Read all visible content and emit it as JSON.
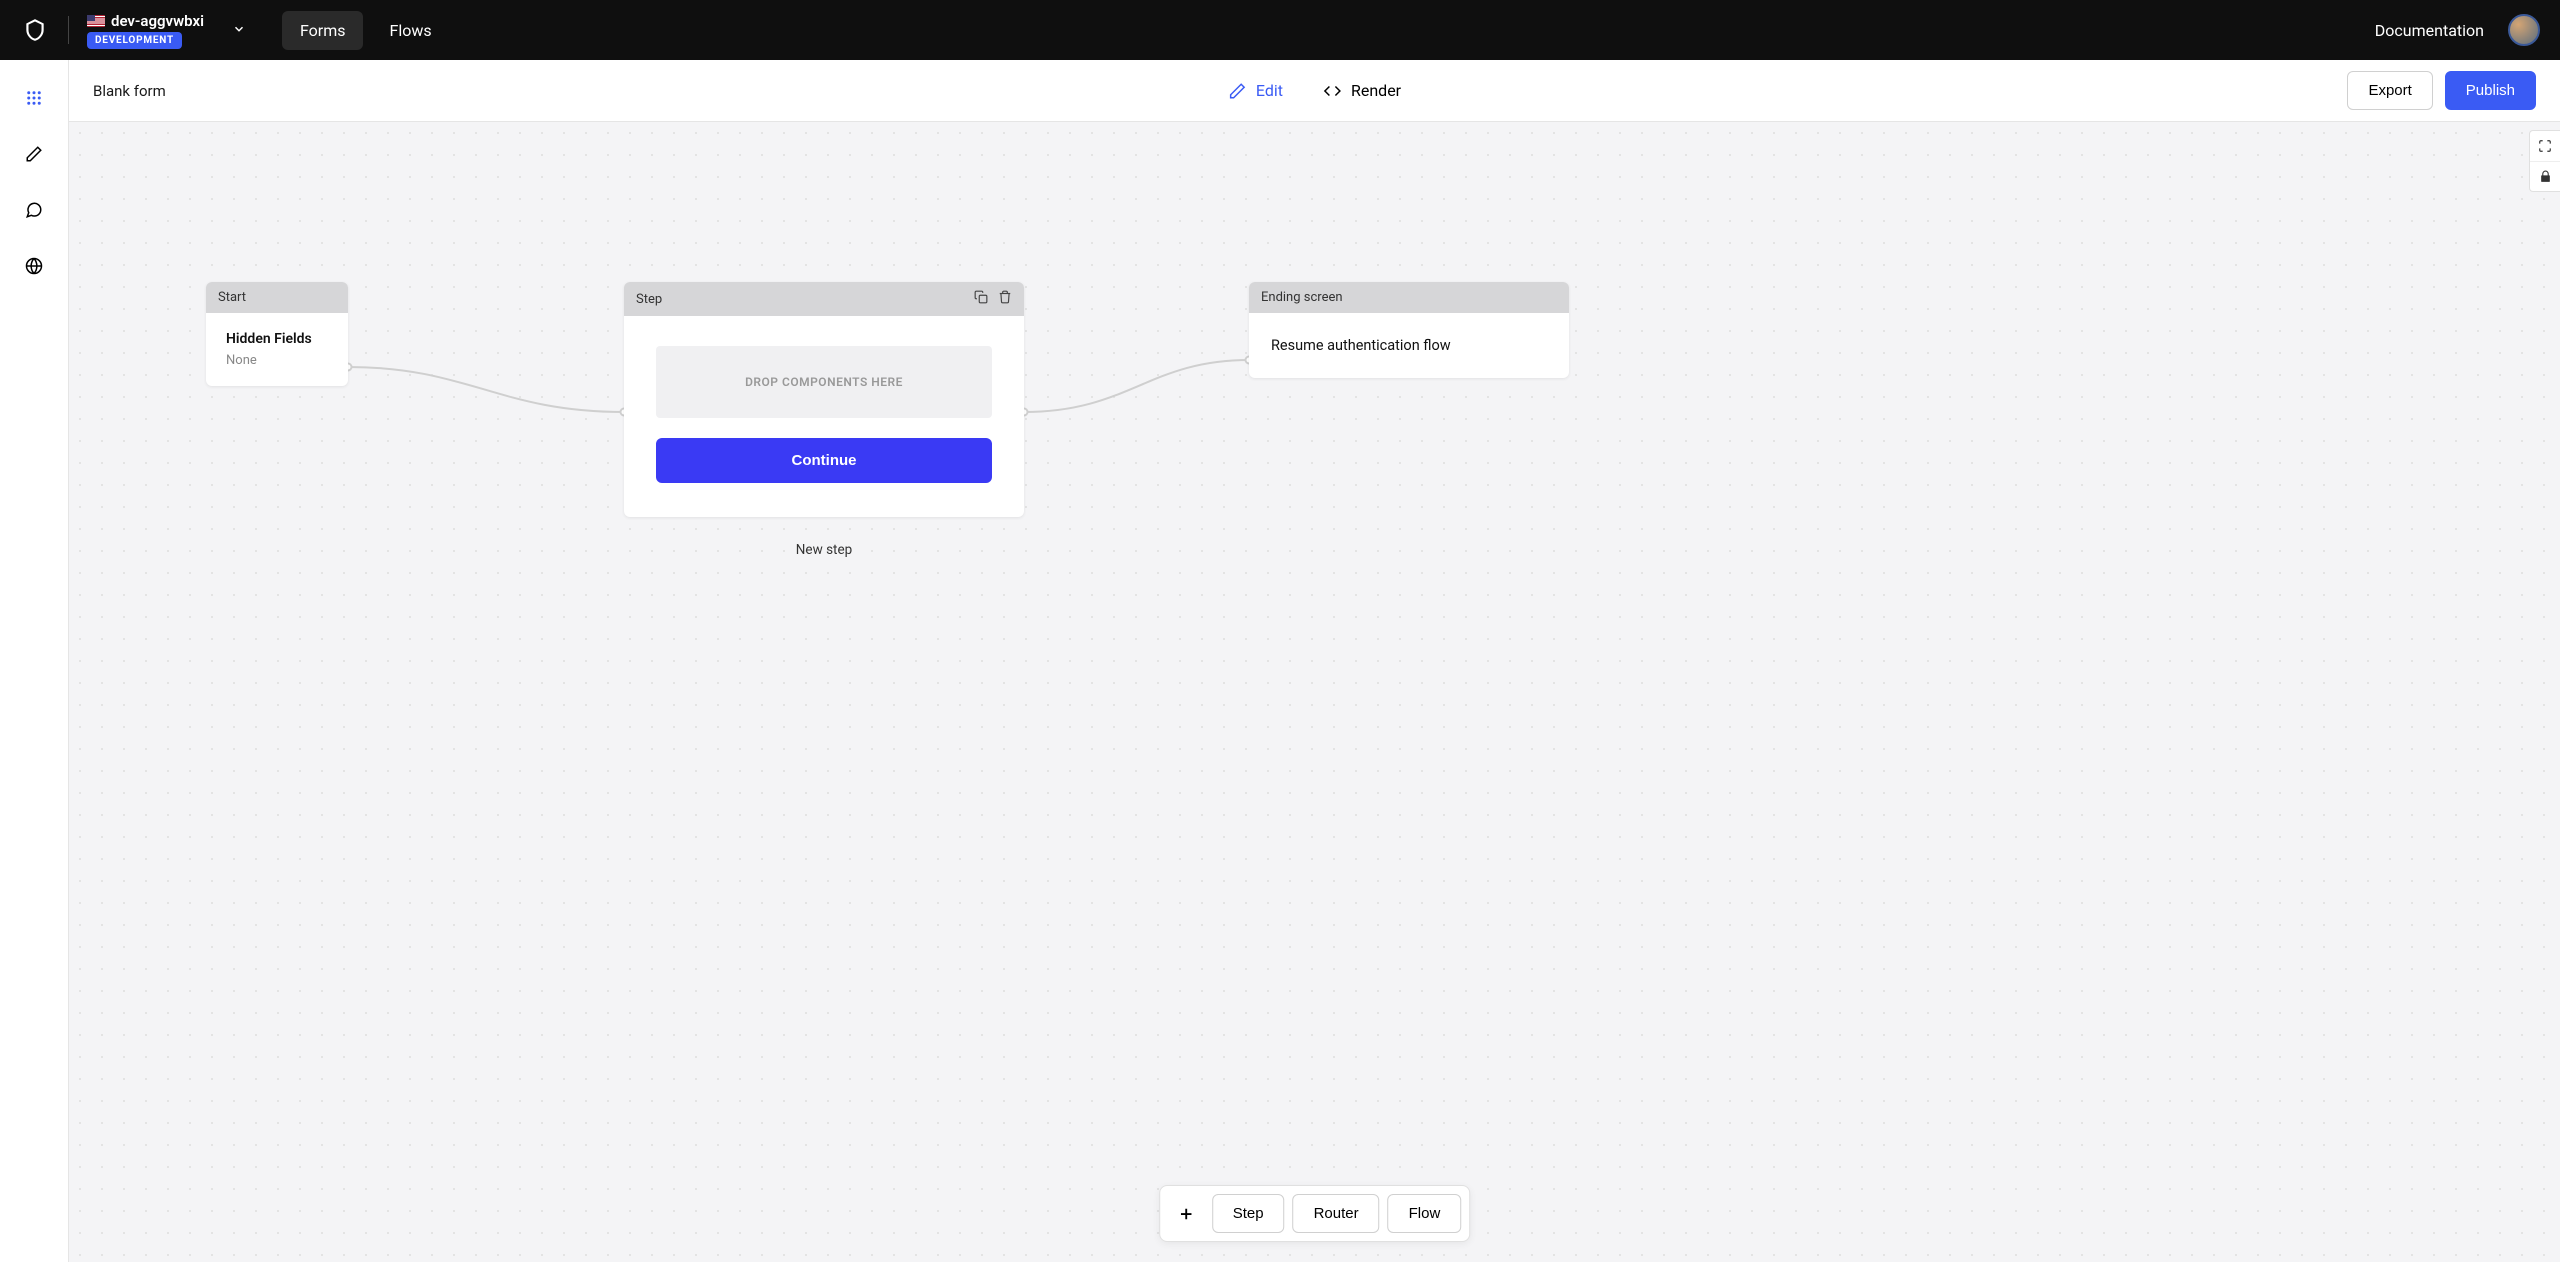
{
  "header": {
    "tenant_name": "dev-aggvwbxi",
    "env_badge": "DEVELOPMENT",
    "tabs": {
      "forms": "Forms",
      "flows": "Flows"
    },
    "documentation": "Documentation"
  },
  "subheader": {
    "form_title": "Blank form",
    "edit": "Edit",
    "render": "Render",
    "export": "Export",
    "publish": "Publish"
  },
  "canvas": {
    "start": {
      "header": "Start",
      "hidden_fields_label": "Hidden Fields",
      "hidden_fields_value": "None"
    },
    "step": {
      "header": "Step",
      "dropzone": "DROP COMPONENTS HERE",
      "continue": "Continue",
      "caption": "New step"
    },
    "end": {
      "header": "Ending screen",
      "body": "Resume authentication flow"
    }
  },
  "bottom_bar": {
    "step": "Step",
    "router": "Router",
    "flow": "Flow"
  }
}
